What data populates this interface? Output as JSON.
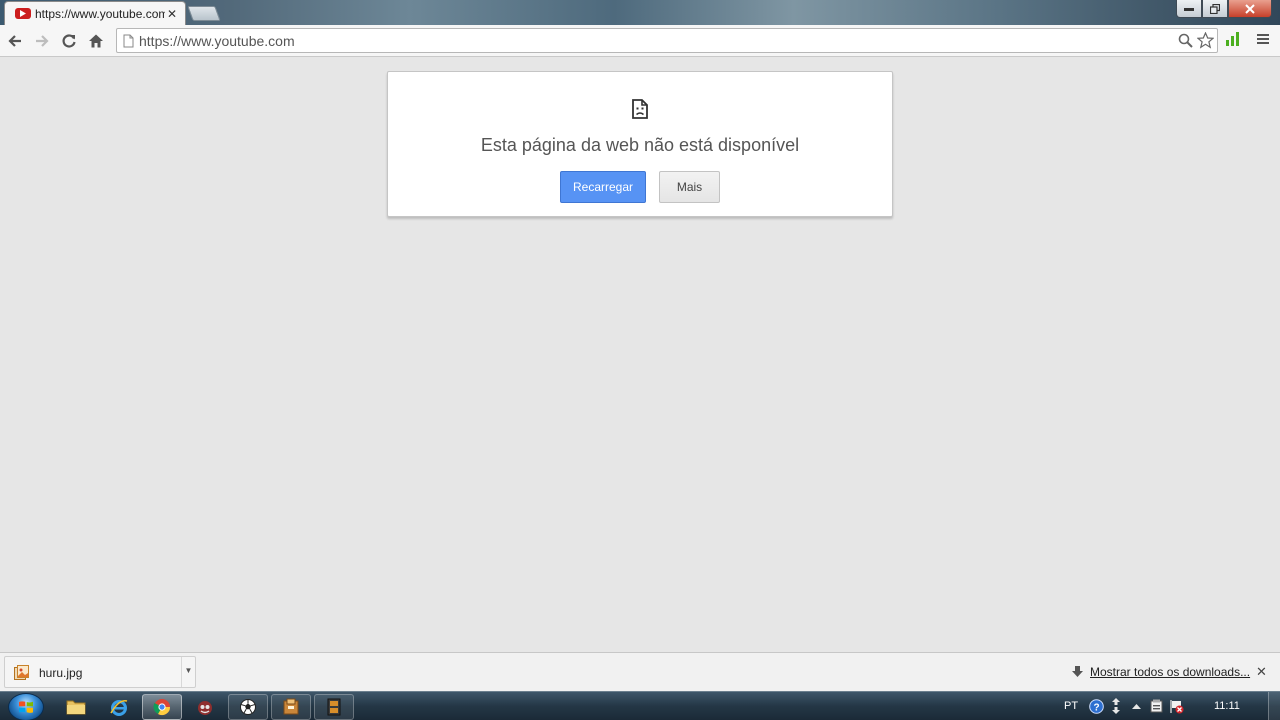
{
  "browser": {
    "tab": {
      "title": "https://www.youtube.com",
      "favicon": "youtube-icon",
      "close": "✕"
    },
    "window_controls": [
      "minimize-icon",
      "restore-icon",
      "close-icon"
    ],
    "url": "https://www.youtube.com",
    "toolbar_icons": [
      "back-arrow-icon",
      "forward-arrow-icon",
      "reload-icon",
      "home-icon",
      "page-icon",
      "search-icon",
      "star-icon",
      "extension-signal-icon",
      "menu-icon"
    ]
  },
  "error_page": {
    "icon": "sad-page-icon",
    "title": "Esta página da web não está disponível",
    "reload_label": "Recarregar",
    "more_label": "Mais",
    "reload_color": "#5793f4"
  },
  "download_shelf": {
    "file_name": "huru.jpg",
    "file_icon": "image-file-icon",
    "show_all_label": "Mostrar todos os downloads...",
    "close": "✕"
  },
  "taskbar": {
    "apps": [
      "file-explorer-icon",
      "internet-explorer-icon",
      "chrome-icon",
      "media-app-icon",
      "soccer-ball-icon",
      "archive-icon",
      "film-icon"
    ],
    "language": "PT",
    "tray_icons": [
      "help-icon",
      "network-arrows-icon",
      "tray-expand-icon",
      "device-icon",
      "action-center-flag-icon"
    ],
    "clock": "11:11"
  }
}
